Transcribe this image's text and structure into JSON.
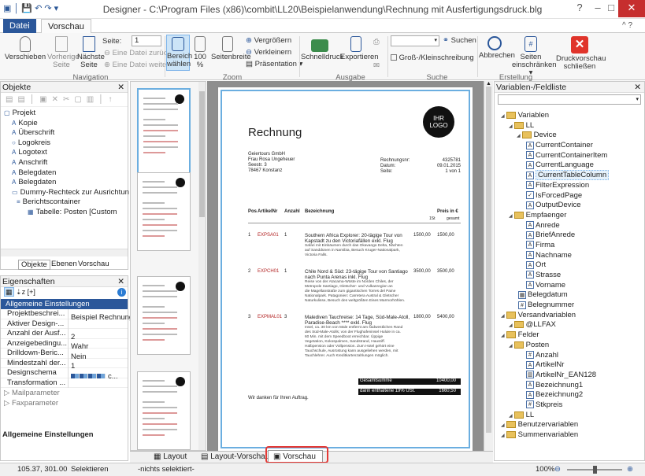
{
  "titlebar": {
    "title": "Designer - C:\\Program Files (x86)\\combit\\LL20\\Beispielanwendung\\Rechnung mit Ausfertigungsdruck.blg",
    "min": "–",
    "max": "□",
    "close": "✕"
  },
  "tabs": {
    "datei": "Datei",
    "vorschau": "Vorschau",
    "help": "^ ?"
  },
  "ribbon": {
    "verschieben": "Verschieben",
    "vorherige": "Vorherige Seite",
    "naechste": "Nächste Seite",
    "seite_label": "Seite:",
    "seite_value": "1",
    "eine_zurueck": "Eine Datei zurück",
    "eine_weiter": "Eine Datei weiter",
    "bereich": "Bereich wählen",
    "zoom100": "100 %",
    "seitenbreite": "Seitenbreite",
    "vergroessern": "Vergrößern",
    "verkleinern": "Verkleinern",
    "praesentation": "Präsentation",
    "schnelldruck": "Schnelldruck",
    "exportieren": "Exportieren",
    "suchen": "Suchen",
    "gross_klein": "Groß-/Kleinschreibung",
    "abbrechen": "Abbrechen",
    "seiten_einschr": "Seiten einschränken",
    "druckvorschau": "Druckvorschau schließen",
    "groups": {
      "navigation": "Navigation",
      "zoom": "Zoom",
      "ausgabe": "Ausgabe",
      "suche": "Suche",
      "erstellung": "Erstellung"
    }
  },
  "objekte": {
    "title": "Objekte",
    "close": "✕",
    "items": [
      "Projekt",
      "Kopie",
      "Überschrift",
      "Logokreis",
      "Logotext",
      "Anschrift",
      "Belegdaten",
      "Belegdaten",
      "Dummy-Rechteck zur Ausrichtun",
      "Berichtscontainer",
      "Tabelle: Posten [Custom"
    ],
    "tabs": [
      "Objekte",
      "Ebenen",
      "Vorschau"
    ]
  },
  "eigenschaften": {
    "title": "Eigenschaften",
    "close": "✕",
    "section": "Allgemeine Einstellungen",
    "rows": [
      [
        "Projektbeschrei...",
        "Beispiel Rechnung"
      ],
      [
        "Aktiver Design-...",
        ""
      ],
      [
        "Anzahl der Ausf...",
        "2"
      ],
      [
        "Anzeigebedingu...",
        "Wahr"
      ],
      [
        "Drilldown-Beric...",
        "Nein"
      ],
      [
        "Mindestzahl der...",
        "1"
      ],
      [
        "Designschema",
        "c..."
      ],
      [
        "Transformation ...",
        ""
      ]
    ],
    "collapsed": [
      "Mailparameter",
      "Faxparameter"
    ],
    "footer": "Allgemeine Einstellungen"
  },
  "variablen": {
    "title": "Variablen-/Feldliste",
    "close": "✕",
    "items": [
      {
        "t": "Variablen",
        "l": 0,
        "k": "folder"
      },
      {
        "t": "LL",
        "l": 1,
        "k": "folder"
      },
      {
        "t": "Device",
        "l": 2,
        "k": "folder"
      },
      {
        "t": "CurrentContainer",
        "l": 2,
        "k": "A"
      },
      {
        "t": "CurrentContainerItem",
        "l": 2,
        "k": "A"
      },
      {
        "t": "CurrentLanguage",
        "l": 2,
        "k": "A"
      },
      {
        "t": "CurrentTableColumn",
        "l": 2,
        "k": "A",
        "sel": true
      },
      {
        "t": "FilterExpression",
        "l": 2,
        "k": "A"
      },
      {
        "t": "IsForcedPage",
        "l": 2,
        "k": "✓"
      },
      {
        "t": "OutputDevice",
        "l": 2,
        "k": "A"
      },
      {
        "t": "Empfaenger",
        "l": 1,
        "k": "folder"
      },
      {
        "t": "Anrede",
        "l": 2,
        "k": "A"
      },
      {
        "t": "BriefAnrede",
        "l": 2,
        "k": "A"
      },
      {
        "t": "Firma",
        "l": 2,
        "k": "A"
      },
      {
        "t": "Nachname",
        "l": 2,
        "k": "A"
      },
      {
        "t": "Ort",
        "l": 2,
        "k": "A"
      },
      {
        "t": "Strasse",
        "l": 2,
        "k": "A"
      },
      {
        "t": "Vorname",
        "l": 2,
        "k": "A"
      },
      {
        "t": "Belegdatum",
        "l": 1,
        "k": "▦"
      },
      {
        "t": "Belegnummer",
        "l": 1,
        "k": "#"
      },
      {
        "t": "Versandvariablen",
        "l": 0,
        "k": "folder"
      },
      {
        "t": "@LLFAX",
        "l": 1,
        "k": "folder"
      },
      {
        "t": "Felder",
        "l": 0,
        "k": "folder"
      },
      {
        "t": "Posten",
        "l": 1,
        "k": "folder"
      },
      {
        "t": "Anzahl",
        "l": 2,
        "k": "#"
      },
      {
        "t": "ArtikelNr",
        "l": 2,
        "k": "A"
      },
      {
        "t": "ArtikelNr_EAN128",
        "l": 2,
        "k": "▥"
      },
      {
        "t": "Bezeichnung1",
        "l": 2,
        "k": "A"
      },
      {
        "t": "Bezeichnung2",
        "l": 2,
        "k": "A"
      },
      {
        "t": "Stkpreis",
        "l": 2,
        "k": "#"
      },
      {
        "t": "LL",
        "l": 1,
        "k": "folder"
      },
      {
        "t": "Benutzervariablen",
        "l": 0,
        "k": "folder"
      },
      {
        "t": "Summenvariablen",
        "l": 0,
        "k": "folder"
      }
    ]
  },
  "bottomtabs": [
    "Layout",
    "Layout-Vorschau",
    "Vorschau"
  ],
  "status": {
    "coords": "105.37, 301.00",
    "mode": "Selektieren",
    "sel": "-nichts selektiert-",
    "zoom": "100%"
  },
  "doc": {
    "logo1": "IHR",
    "logo2": "LOGO",
    "title": "Rechnung",
    "sender": [
      "Geiertours GmbH",
      "Frau Rosa Ungeheuer",
      "Seestr. 3",
      "78467 Konstanz"
    ],
    "meta_k": [
      "Rechnungsnr:",
      "Datum:",
      "Seite:"
    ],
    "meta_v": [
      "4325781",
      "09.01.2015",
      "1 von 1"
    ],
    "head": [
      "Pos",
      "ArtikelNr",
      "Anzahl",
      "Bezeichnung",
      "Preis in €"
    ],
    "head2": [
      "1St",
      "gesamt"
    ],
    "rows": [
      {
        "pos": "1",
        "art": "EXPSA01",
        "anz": "1",
        "title": "Southern Africa Explorer: 20-tägige Tour von",
        "title2": "Kapstadt zu den Victoriafällen exkl. Flug",
        "p1": "1500,00",
        "p2": "1500,00",
        "desc": [
          "Safari mit Einbäumen durch das Okavango Delta, Nächten",
          "auf Sanddünen in Namibia, Besuch Kruger-Nationalpark,",
          "Victoria Falls."
        ]
      },
      {
        "pos": "2",
        "art": "EXPCH01",
        "anz": "1",
        "title": "Chile Nord & Süd: 23-tägige Tour von Santiago",
        "title2": "nach Punta Arenas inkl. Flug",
        "p1": "3500,00",
        "p2": "3500,00",
        "desc": [
          "Reise von der Atacama-Wüste im Norden Chiles, der",
          "Metropole Santiago, Gletscher- und Vulkanregion an",
          "die Magellanstraße zum gigantischen Torres del Paine",
          "Nationalpark. Patagonien: Carretera Austral & Gletscher",
          "Naturkulisse, Besuch des weltgrößten Eises Marmorhöhlen."
        ]
      },
      {
        "pos": "3",
        "art": "EXPMAL01",
        "anz": "3",
        "title": "Malediven Tauchreise: 14 Tage, Süd-Male-Atoll,",
        "title2": "Paradise-Beach **** exkl. Flug",
        "p1": "1800,00",
        "p2": "5400,00",
        "desc": [
          "Insel, ca. 30 km von Male entfernt am südwestlichen Rand",
          "des Süd-Male-Atolls; von der Flughafeninsel Hulule in ca.",
          "60 Min. mit dem Speedboot erreichbar. Üppige",
          "Vegetation, Kokospalmen, Sandstrand, Hausriff.",
          "Halbpension oder Vollpension. Zum Hotel gehört eine",
          "Tauchschule, Ausrüstung kann ausgeliehen werden, mit",
          "Tauchlehrer. Auch Kreditkartenzahlungen möglich."
        ]
      }
    ],
    "sum1_k": "Gesamtsumme",
    "sum1_v": "10400,00",
    "sum2_k": "darin enthaltene 19% USt.",
    "sum2_v": "1660,50",
    "footer": "Wir danken für Ihren Auftrag."
  },
  "colors": {
    "accent": "#2b579a",
    "selection": "#cce4f7",
    "docbg": "#8e8e8e",
    "highlight": "#e53935"
  }
}
